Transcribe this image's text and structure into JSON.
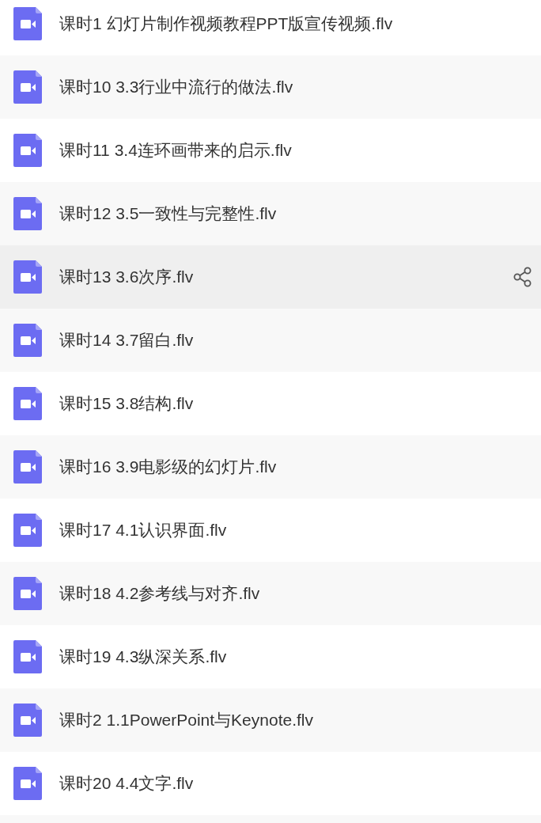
{
  "files": [
    {
      "name": "课时1 幻灯片制作视频教程PPT版宣传视频.flv",
      "hovered": false
    },
    {
      "name": "课时10 3.3行业中流行的做法.flv",
      "hovered": false
    },
    {
      "name": "课时11 3.4连环画带来的启示.flv",
      "hovered": false
    },
    {
      "name": "课时12 3.5一致性与完整性.flv",
      "hovered": false
    },
    {
      "name": "课时13 3.6次序.flv",
      "hovered": true
    },
    {
      "name": "课时14 3.7留白.flv",
      "hovered": false
    },
    {
      "name": "课时15 3.8结构.flv",
      "hovered": false
    },
    {
      "name": "课时16 3.9电影级的幻灯片.flv",
      "hovered": false
    },
    {
      "name": "课时17 4.1认识界面.flv",
      "hovered": false
    },
    {
      "name": "课时18 4.2参考线与对齐.flv",
      "hovered": false
    },
    {
      "name": "课时19 4.3纵深关系.flv",
      "hovered": false
    },
    {
      "name": "课时2 1.1PowerPoint与Keynote.flv",
      "hovered": false
    },
    {
      "name": "课时20 4.4文字.flv",
      "hovered": false
    }
  ]
}
